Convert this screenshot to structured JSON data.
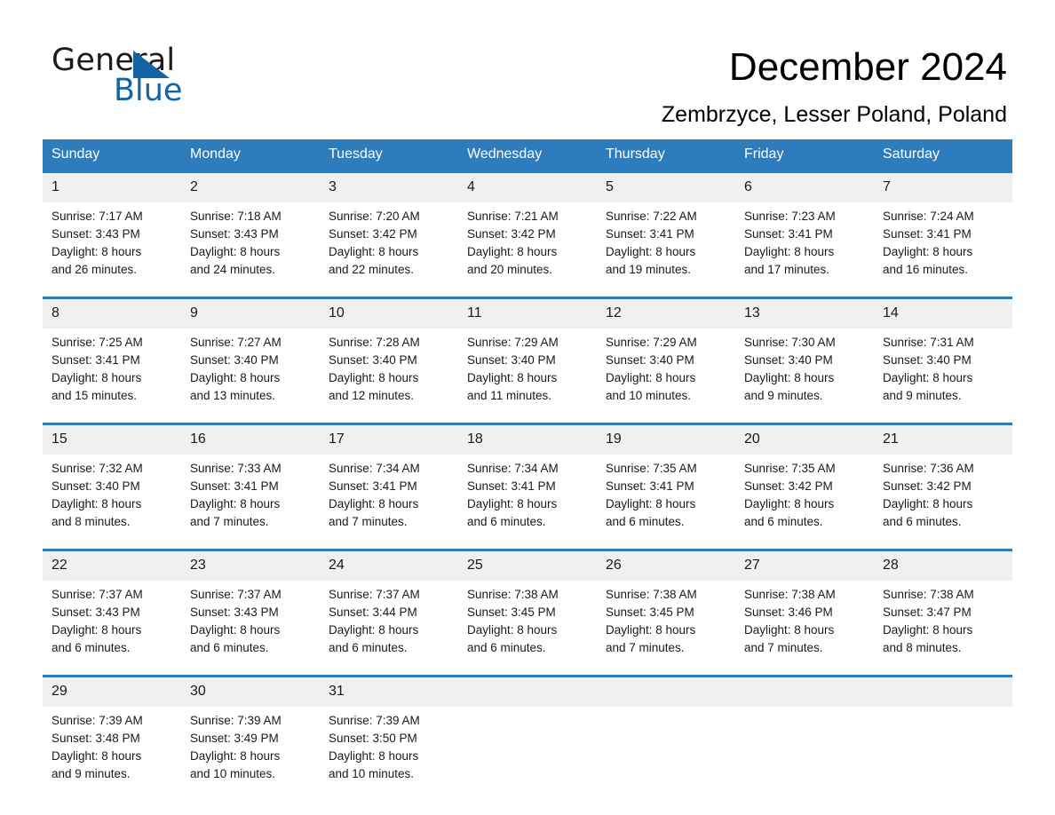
{
  "brand": {
    "name_part1": "General",
    "name_part2": "Blue",
    "triangle_icon": "triangle-icon",
    "accent_color": "#1464a5"
  },
  "header": {
    "title": "December 2024",
    "subtitle": "Zembrzyce, Lesser Poland, Poland"
  },
  "calendar": {
    "header_bg": "#2f7cbd",
    "daynum_bg": "#f0f0f0",
    "weekdays": [
      "Sunday",
      "Monday",
      "Tuesday",
      "Wednesday",
      "Thursday",
      "Friday",
      "Saturday"
    ],
    "weeks": [
      [
        {
          "day": "1",
          "sunrise": "Sunrise: 7:17 AM",
          "sunset": "Sunset: 3:43 PM",
          "daylight1": "Daylight: 8 hours",
          "daylight2": "and 26 minutes."
        },
        {
          "day": "2",
          "sunrise": "Sunrise: 7:18 AM",
          "sunset": "Sunset: 3:43 PM",
          "daylight1": "Daylight: 8 hours",
          "daylight2": "and 24 minutes."
        },
        {
          "day": "3",
          "sunrise": "Sunrise: 7:20 AM",
          "sunset": "Sunset: 3:42 PM",
          "daylight1": "Daylight: 8 hours",
          "daylight2": "and 22 minutes."
        },
        {
          "day": "4",
          "sunrise": "Sunrise: 7:21 AM",
          "sunset": "Sunset: 3:42 PM",
          "daylight1": "Daylight: 8 hours",
          "daylight2": "and 20 minutes."
        },
        {
          "day": "5",
          "sunrise": "Sunrise: 7:22 AM",
          "sunset": "Sunset: 3:41 PM",
          "daylight1": "Daylight: 8 hours",
          "daylight2": "and 19 minutes."
        },
        {
          "day": "6",
          "sunrise": "Sunrise: 7:23 AM",
          "sunset": "Sunset: 3:41 PM",
          "daylight1": "Daylight: 8 hours",
          "daylight2": "and 17 minutes."
        },
        {
          "day": "7",
          "sunrise": "Sunrise: 7:24 AM",
          "sunset": "Sunset: 3:41 PM",
          "daylight1": "Daylight: 8 hours",
          "daylight2": "and 16 minutes."
        }
      ],
      [
        {
          "day": "8",
          "sunrise": "Sunrise: 7:25 AM",
          "sunset": "Sunset: 3:41 PM",
          "daylight1": "Daylight: 8 hours",
          "daylight2": "and 15 minutes."
        },
        {
          "day": "9",
          "sunrise": "Sunrise: 7:27 AM",
          "sunset": "Sunset: 3:40 PM",
          "daylight1": "Daylight: 8 hours",
          "daylight2": "and 13 minutes."
        },
        {
          "day": "10",
          "sunrise": "Sunrise: 7:28 AM",
          "sunset": "Sunset: 3:40 PM",
          "daylight1": "Daylight: 8 hours",
          "daylight2": "and 12 minutes."
        },
        {
          "day": "11",
          "sunrise": "Sunrise: 7:29 AM",
          "sunset": "Sunset: 3:40 PM",
          "daylight1": "Daylight: 8 hours",
          "daylight2": "and 11 minutes."
        },
        {
          "day": "12",
          "sunrise": "Sunrise: 7:29 AM",
          "sunset": "Sunset: 3:40 PM",
          "daylight1": "Daylight: 8 hours",
          "daylight2": "and 10 minutes."
        },
        {
          "day": "13",
          "sunrise": "Sunrise: 7:30 AM",
          "sunset": "Sunset: 3:40 PM",
          "daylight1": "Daylight: 8 hours",
          "daylight2": "and 9 minutes."
        },
        {
          "day": "14",
          "sunrise": "Sunrise: 7:31 AM",
          "sunset": "Sunset: 3:40 PM",
          "daylight1": "Daylight: 8 hours",
          "daylight2": "and 9 minutes."
        }
      ],
      [
        {
          "day": "15",
          "sunrise": "Sunrise: 7:32 AM",
          "sunset": "Sunset: 3:40 PM",
          "daylight1": "Daylight: 8 hours",
          "daylight2": "and 8 minutes."
        },
        {
          "day": "16",
          "sunrise": "Sunrise: 7:33 AM",
          "sunset": "Sunset: 3:41 PM",
          "daylight1": "Daylight: 8 hours",
          "daylight2": "and 7 minutes."
        },
        {
          "day": "17",
          "sunrise": "Sunrise: 7:34 AM",
          "sunset": "Sunset: 3:41 PM",
          "daylight1": "Daylight: 8 hours",
          "daylight2": "and 7 minutes."
        },
        {
          "day": "18",
          "sunrise": "Sunrise: 7:34 AM",
          "sunset": "Sunset: 3:41 PM",
          "daylight1": "Daylight: 8 hours",
          "daylight2": "and 6 minutes."
        },
        {
          "day": "19",
          "sunrise": "Sunrise: 7:35 AM",
          "sunset": "Sunset: 3:41 PM",
          "daylight1": "Daylight: 8 hours",
          "daylight2": "and 6 minutes."
        },
        {
          "day": "20",
          "sunrise": "Sunrise: 7:35 AM",
          "sunset": "Sunset: 3:42 PM",
          "daylight1": "Daylight: 8 hours",
          "daylight2": "and 6 minutes."
        },
        {
          "day": "21",
          "sunrise": "Sunrise: 7:36 AM",
          "sunset": "Sunset: 3:42 PM",
          "daylight1": "Daylight: 8 hours",
          "daylight2": "and 6 minutes."
        }
      ],
      [
        {
          "day": "22",
          "sunrise": "Sunrise: 7:37 AM",
          "sunset": "Sunset: 3:43 PM",
          "daylight1": "Daylight: 8 hours",
          "daylight2": "and 6 minutes."
        },
        {
          "day": "23",
          "sunrise": "Sunrise: 7:37 AM",
          "sunset": "Sunset: 3:43 PM",
          "daylight1": "Daylight: 8 hours",
          "daylight2": "and 6 minutes."
        },
        {
          "day": "24",
          "sunrise": "Sunrise: 7:37 AM",
          "sunset": "Sunset: 3:44 PM",
          "daylight1": "Daylight: 8 hours",
          "daylight2": "and 6 minutes."
        },
        {
          "day": "25",
          "sunrise": "Sunrise: 7:38 AM",
          "sunset": "Sunset: 3:45 PM",
          "daylight1": "Daylight: 8 hours",
          "daylight2": "and 6 minutes."
        },
        {
          "day": "26",
          "sunrise": "Sunrise: 7:38 AM",
          "sunset": "Sunset: 3:45 PM",
          "daylight1": "Daylight: 8 hours",
          "daylight2": "and 7 minutes."
        },
        {
          "day": "27",
          "sunrise": "Sunrise: 7:38 AM",
          "sunset": "Sunset: 3:46 PM",
          "daylight1": "Daylight: 8 hours",
          "daylight2": "and 7 minutes."
        },
        {
          "day": "28",
          "sunrise": "Sunrise: 7:38 AM",
          "sunset": "Sunset: 3:47 PM",
          "daylight1": "Daylight: 8 hours",
          "daylight2": "and 8 minutes."
        }
      ],
      [
        {
          "day": "29",
          "sunrise": "Sunrise: 7:39 AM",
          "sunset": "Sunset: 3:48 PM",
          "daylight1": "Daylight: 8 hours",
          "daylight2": "and 9 minutes."
        },
        {
          "day": "30",
          "sunrise": "Sunrise: 7:39 AM",
          "sunset": "Sunset: 3:49 PM",
          "daylight1": "Daylight: 8 hours",
          "daylight2": "and 10 minutes."
        },
        {
          "day": "31",
          "sunrise": "Sunrise: 7:39 AM",
          "sunset": "Sunset: 3:50 PM",
          "daylight1": "Daylight: 8 hours",
          "daylight2": "and 10 minutes."
        },
        {
          "day": "",
          "sunrise": "",
          "sunset": "",
          "daylight1": "",
          "daylight2": ""
        },
        {
          "day": "",
          "sunrise": "",
          "sunset": "",
          "daylight1": "",
          "daylight2": ""
        },
        {
          "day": "",
          "sunrise": "",
          "sunset": "",
          "daylight1": "",
          "daylight2": ""
        },
        {
          "day": "",
          "sunrise": "",
          "sunset": "",
          "daylight1": "",
          "daylight2": ""
        }
      ]
    ]
  }
}
